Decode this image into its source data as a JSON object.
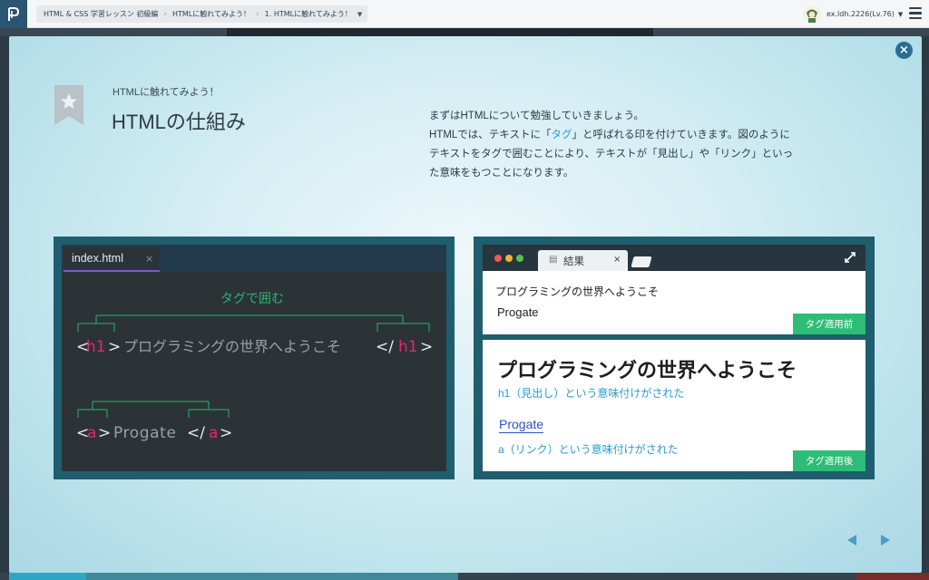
{
  "topbar": {
    "breadcrumbs": [
      "HTML & CSS 学習レッスン 初級編",
      "HTMLに触れてみよう！",
      "1. HTMLに触れてみよう！"
    ],
    "user_name": "ex.ldh.2226(Lv.76)"
  },
  "slide": {
    "subtitle": "HTMLに触れてみよう！",
    "title": "HTMLの仕組み",
    "description": {
      "line1": "まずはHTMLについて勉強していきましょう。",
      "line2_pre": "HTMLでは、テキストに「",
      "line2_hl": "タグ",
      "line2_post": "」と呼ばれる印を付けていきます。図のように",
      "line3": "テキストをタグで囲むことにより、テキストが「見出し」や「リンク」といっ",
      "line4": "た意味をもつことになります。"
    }
  },
  "editor": {
    "tab_name": "index.html",
    "tab_close": "×",
    "annotation": "タグで囲む",
    "h1_line": {
      "lt": "<",
      "tag": "h1",
      "gt": ">",
      "text": "プログラミングの世界へようこそ",
      "close_lt": "</",
      "close_tag": "h1",
      "close_gt": ">"
    },
    "a_line": {
      "lt": "<",
      "tag": "a",
      "gt": ">",
      "text": "Progate",
      "close_lt": "</",
      "close_tag": "a",
      "close_gt": ">"
    }
  },
  "result": {
    "tab_label": "結果",
    "tab_close": "×",
    "before": {
      "heading": "プログラミングの世界へようこそ",
      "link": "Progate",
      "badge": "タグ適用前"
    },
    "after": {
      "heading": "プログラミングの世界へようこそ",
      "heading_note": "h1（見出し）という意味付けがされた",
      "link": "Progate",
      "link_note": "a（リンク）という意味付けがされた",
      "badge": "タグ適用後"
    }
  },
  "colors": {
    "tag_pink": "#e8266b",
    "annotation_green": "#2fb36f",
    "highlight_blue": "#2a9bd2",
    "badge_green": "#2dbd76"
  }
}
